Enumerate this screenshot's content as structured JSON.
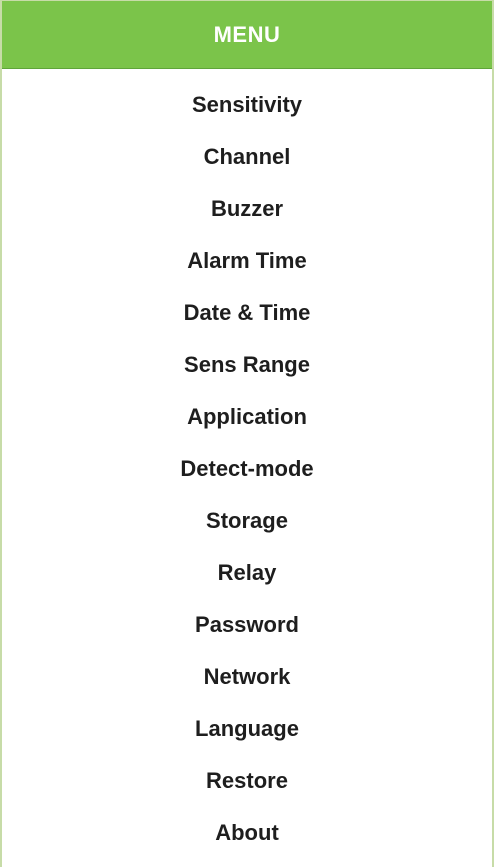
{
  "menu": {
    "title": "MENU",
    "items": [
      {
        "label": "Sensitivity"
      },
      {
        "label": "Channel"
      },
      {
        "label": "Buzzer"
      },
      {
        "label": "Alarm Time"
      },
      {
        "label": "Date & Time"
      },
      {
        "label": "Sens Range"
      },
      {
        "label": "Application"
      },
      {
        "label": "Detect-mode"
      },
      {
        "label": "Storage"
      },
      {
        "label": "Relay"
      },
      {
        "label": "Password"
      },
      {
        "label": "Network"
      },
      {
        "label": "Language"
      },
      {
        "label": "Restore"
      },
      {
        "label": "About"
      }
    ]
  },
  "colors": {
    "header_background": "#7bc44a",
    "header_text": "#ffffff",
    "item_text": "#1e1e1e",
    "border": "#c7dca8"
  }
}
